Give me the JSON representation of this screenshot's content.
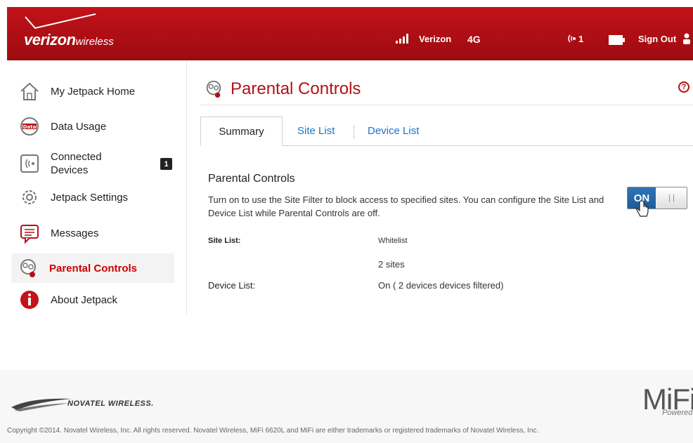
{
  "header": {
    "brand": "verizon",
    "brand_suffix": "wireless",
    "carrier": "Verizon",
    "network": "4G",
    "connected_count": "1",
    "sign_out": "Sign Out"
  },
  "sidebar": {
    "items": [
      {
        "label": "My Jetpack Home",
        "icon": "house-icon"
      },
      {
        "label": "Data Usage",
        "icon": "data-usage-icon"
      },
      {
        "label": "Connected Devices",
        "icon": "connected-devices-icon",
        "badge": "1"
      },
      {
        "label": "Jetpack Settings",
        "icon": "gear-icon"
      },
      {
        "label": "Messages",
        "icon": "message-icon"
      },
      {
        "label": "Parental Controls",
        "icon": "parental-controls-icon",
        "active": true
      },
      {
        "label": "About Jetpack",
        "icon": "info-icon"
      }
    ]
  },
  "main": {
    "title": "Parental Controls",
    "tabs": [
      "Summary",
      "Site List",
      "Device List"
    ],
    "section_title": "Parental Controls",
    "description": "Turn on to use the Site Filter to block access to specified sites. You can configure the Site List and Device List while Parental Controls are off.",
    "toggle_state": "ON",
    "rows": [
      {
        "label": "Site List:",
        "value": "Whitelist"
      },
      {
        "label": "",
        "value": "2 sites"
      },
      {
        "label": "Device List:",
        "value": "On ( 2 devices devices filtered)"
      }
    ]
  },
  "footer": {
    "novatel": "NOVATEL WIRELESS.",
    "mifi": "MiFi",
    "powered": "Powered",
    "copyright": "Copyright ©2014. Novatel Wireless, Inc. All rights reserved. Novatel Wireless, MiFi 6620L and MiFi are either trademarks or registered trademarks of Novatel Wireless, Inc."
  },
  "colors": {
    "brand_red": "#c3121a",
    "accent_red": "#b21216",
    "link_blue": "#1a73c9",
    "toggle_blue": "#2f73b8"
  }
}
